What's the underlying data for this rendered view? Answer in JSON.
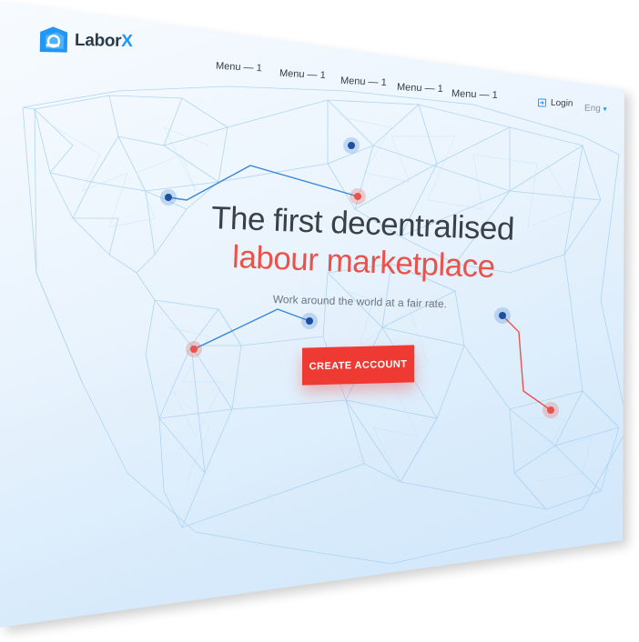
{
  "brand": {
    "name_main": "Labor",
    "name_accent": "X"
  },
  "nav": {
    "menu": [
      "Menu — 1",
      "Menu — 1",
      "Menu — 1",
      "Menu — 1",
      "Menu — 1"
    ],
    "login_label": "Login",
    "language": "Eng",
    "language_caret": "▾"
  },
  "hero": {
    "headline": "The first decentralised",
    "subheadline": "labour marketplace",
    "tagline": "Work around the world at a fair rate.",
    "cta_label": "CREATE ACCOUNT"
  },
  "colors": {
    "accent_red": "#ef3a33",
    "accent_blue": "#2196f3",
    "text_dark": "#3a4047",
    "map_lines": "#a9d2f3"
  },
  "icons": [
    "logo-mark-icon",
    "login-icon",
    "caret-down-icon",
    "network-node-icon"
  ]
}
